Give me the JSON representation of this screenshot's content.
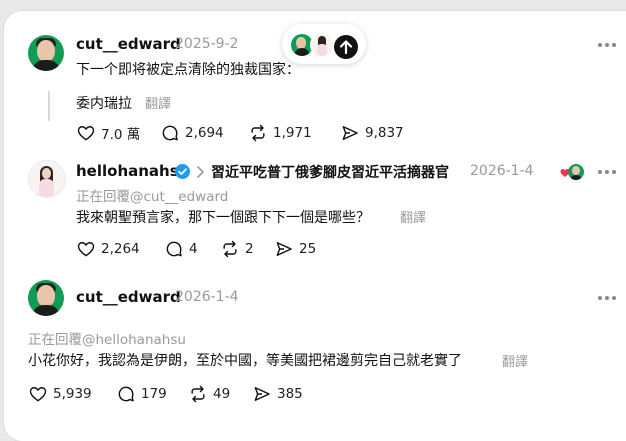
{
  "posts": [
    {
      "username": "cut__edward",
      "date": "2025-9-2",
      "text": "下一个即将被定点清除的独裁国家：",
      "quoted_text": "委内瑞拉",
      "translate": "翻譯",
      "likes": "7.0 萬",
      "comments": "2,694",
      "reposts": "1,971",
      "shares": "9,837"
    },
    {
      "username": "hellohanahsu",
      "verified": true,
      "topic": "習近平吃普丁俄爹腳皮習近平活摘器官",
      "date": "2026-1-4",
      "replying_to": "正在回覆@cut__edward",
      "text": "我來朝聖預言家，那下一個跟下下一個是哪些？",
      "translate": "翻譯",
      "likes": "2,264",
      "comments": "4",
      "reposts": "2",
      "shares": "25"
    },
    {
      "username": "cut__edward",
      "date": "2026-1-4",
      "replying_to": "正在回覆@hellohanahsu",
      "text": "小花你好，我認為是伊朗，至於中國，等美國把裙邊剪完自己就老實了",
      "translate": "翻譯",
      "likes": "5,939",
      "comments": "179",
      "reposts": "49",
      "shares": "385"
    }
  ],
  "colors": {
    "verified": "#1d9bf0",
    "muted_text": "#9a9a9a",
    "edward_avatar_bg": "#0f9d53"
  },
  "icons": [
    "more-icon",
    "heart-icon",
    "comment-icon",
    "repost-icon",
    "share-icon",
    "verified-icon",
    "chevron-right-icon",
    "arrow-up-icon"
  ]
}
